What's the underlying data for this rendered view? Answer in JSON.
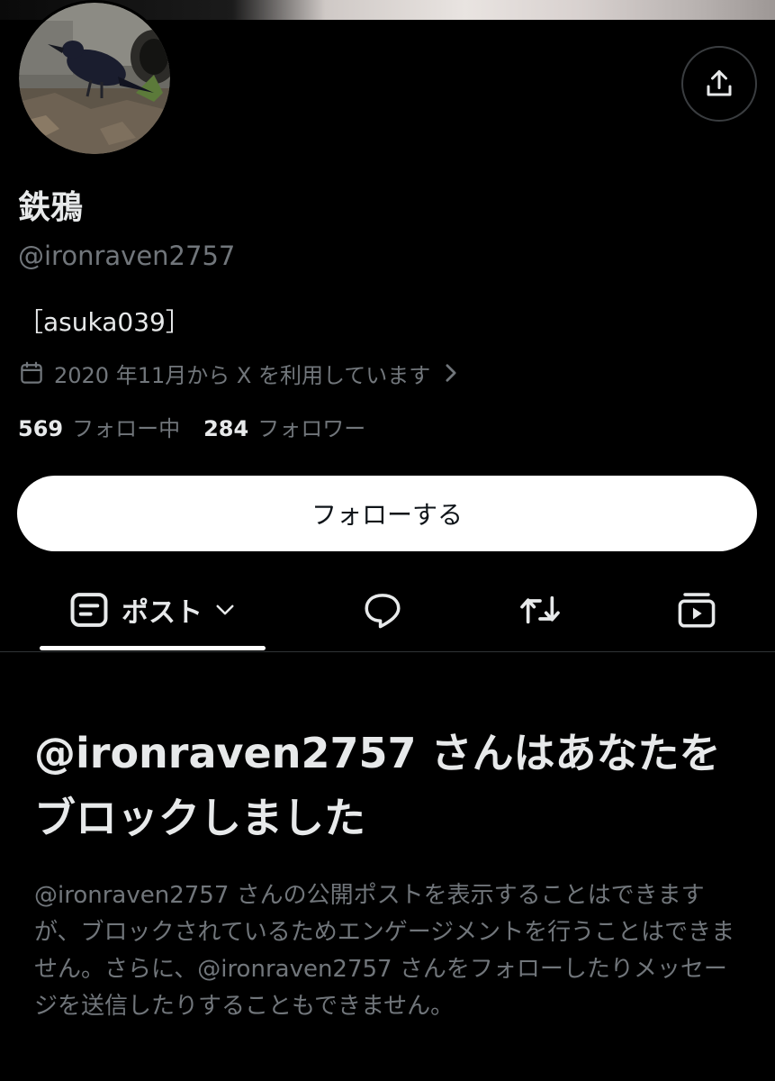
{
  "profile": {
    "display_name": "鉄鴉",
    "handle": "@ironraven2757",
    "bio": "［asuka039］",
    "joined": "2020 年11月から X を利用しています",
    "following_count": "569",
    "following_label": "フォロー中",
    "followers_count": "284",
    "followers_label": "フォロワー"
  },
  "actions": {
    "follow_label": "フォローする",
    "share_icon": "share-icon"
  },
  "tabs": [
    {
      "label": "ポスト",
      "icon": "posts-icon",
      "selected": true
    },
    {
      "label": "",
      "icon": "reply-icon",
      "selected": false
    },
    {
      "label": "",
      "icon": "repost-icon",
      "selected": false
    },
    {
      "label": "",
      "icon": "media-icon",
      "selected": false
    }
  ],
  "blocked": {
    "title": "@ironraven2757 さんはあなたをブロックしました",
    "body": "@ironraven2757 さんの公開ポストを表示することはできますが、ブロックされているためエンゲージメントを行うことはできません。さらに、@ironraven2757 さんをフォローしたりメッセージを送信したりすることもできません。"
  },
  "colors": {
    "background": "#000000",
    "primary_text": "#e7e9ea",
    "secondary_text": "#71767b",
    "button_bg": "#ffffff",
    "divider": "#2f3336"
  }
}
